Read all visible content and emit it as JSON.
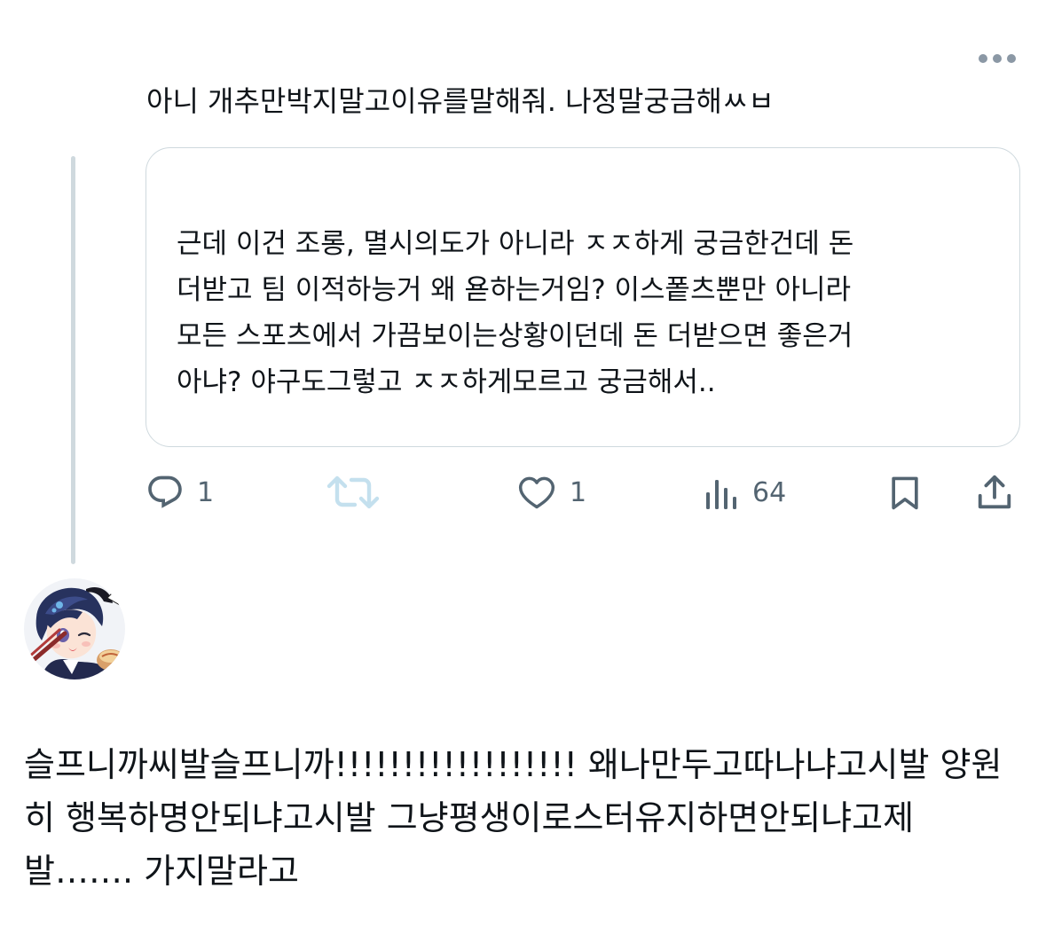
{
  "tweet_menu": {
    "icon": "more-horizontal-icon"
  },
  "reply": {
    "text": "아니 개추만박지말고이유를말해줘. 나정말궁금해ㅆㅂ"
  },
  "quoted_tweet": {
    "lines": [
      "근데 이건 조롱, 멸시의도가 아니라 ㅈㅈ하게 궁금한건데 돈",
      "더받고 팀 이적하능거 왜 욛하는거임? 이스퐅츠뿐만 아니라",
      "모든 스포츠에서 가끔보이는상황이던데 돈 더받으면 좋은거",
      "아냐? 야구도그렇고 ㅈㅈ하게모르고 궁금해서.."
    ]
  },
  "actions": {
    "reply": {
      "icon": "reply-icon",
      "count": "1"
    },
    "repost": {
      "icon": "repost-icon"
    },
    "like": {
      "icon": "heart-icon",
      "count": "1"
    },
    "views": {
      "icon": "views-icon",
      "count": "64"
    },
    "bookmark": {
      "icon": "bookmark-icon"
    },
    "share": {
      "icon": "share-icon"
    }
  },
  "colors": {
    "text": "#0f1419",
    "muted": "#536471",
    "border": "#cfd9de",
    "repost_disabled": "#c4e0ee"
  },
  "main_tweet": {
    "lines": [
      "슬프니까씨발슬프니까!!!!!!!!!!!!!!!!!! 왜나만두고따나냐고시발 양원",
      "히 행복하명안되냐고시발 그냥평생이로스터유지하면안되냐고제",
      "발……. 가지말라고"
    ]
  }
}
